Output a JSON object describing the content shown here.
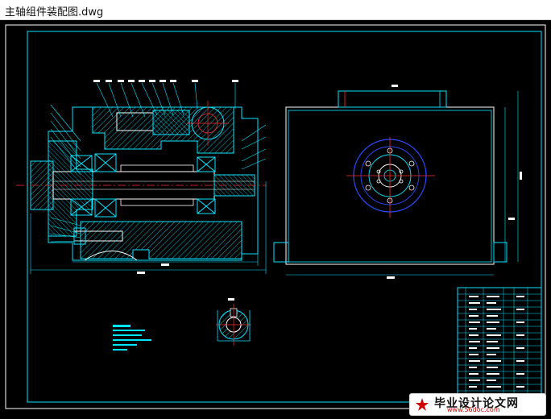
{
  "window": {
    "title": "主轴组件装配图.dwg"
  },
  "drawing": {
    "line_color": "#00e5ff",
    "center_line_color": "#ff2b2b",
    "hatch_color": "#00e5ff",
    "highlight_color": "#ffffff",
    "dim_color": "#ffff00",
    "accent_blue": "#2a4cff",
    "background": "#000000"
  },
  "watermark": {
    "text": "毕业设计论文网",
    "url": "www.56doc.com",
    "logo_icon": "red-star-logo-icon"
  }
}
